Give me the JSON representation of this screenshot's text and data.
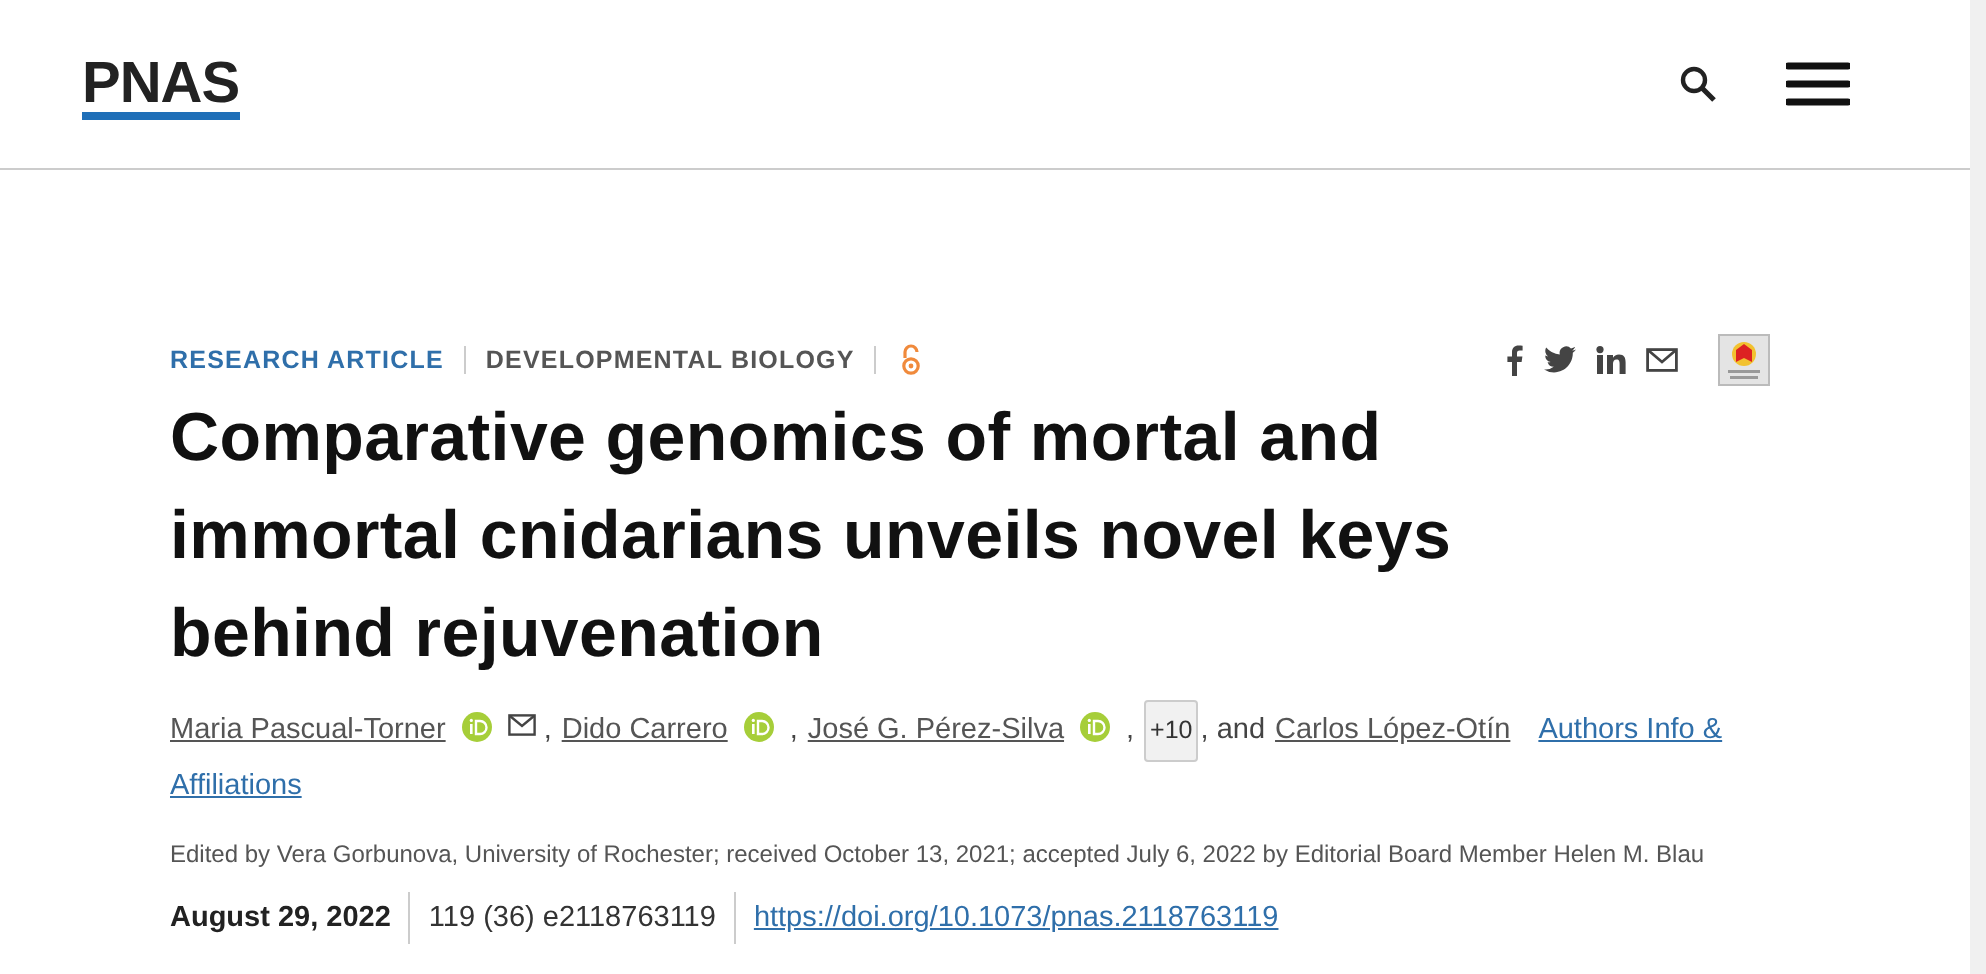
{
  "header": {
    "logo": "PNAS"
  },
  "article": {
    "type": "RESEARCH ARTICLE",
    "subject": "DEVELOPMENTAL BIOLOGY",
    "open_access": true,
    "title": "Comparative genomics of mortal and immortal cnidarians unveils novel keys behind rejuvenation",
    "byline": [
      {
        "kind": "author",
        "name": "Maria Pascual-Torner"
      },
      {
        "kind": "orcid"
      },
      {
        "kind": "email"
      },
      {
        "kind": "text",
        "text": ","
      },
      {
        "kind": "author",
        "name": "Dido Carrero"
      },
      {
        "kind": "orcid"
      },
      {
        "kind": "text",
        "text": ","
      },
      {
        "kind": "author",
        "name": "José G. Pérez-Silva"
      },
      {
        "kind": "orcid"
      },
      {
        "kind": "text",
        "text": ","
      },
      {
        "kind": "more",
        "text": "+10"
      },
      {
        "kind": "text",
        "text": ", and"
      },
      {
        "kind": "author",
        "name": "Carlos López-Otín"
      },
      {
        "kind": "link",
        "text": "Authors Info &"
      },
      {
        "kind": "link",
        "text": "Affiliations"
      }
    ],
    "edited": "Edited by Vera Gorbunova, University of Rochester; received October 13, 2021; accepted July 6, 2022 by Editorial Board Member Helen M. Blau",
    "date": "August 29, 2022",
    "citation": "119 (36) e2118763119",
    "doi": "https://doi.org/10.1073/pnas.2118763119"
  }
}
